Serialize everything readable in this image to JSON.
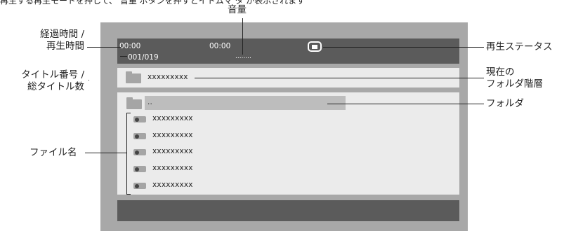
{
  "top_text": "再生する再生モードを押して、 音量 ボタンを押すとイトムマ タ  が表示されます",
  "labels": {
    "volume": "音量",
    "elapsed_total_time": "経過時間 /\n再生時間",
    "title_number": "タイトル番号 /\n総タイトル数",
    "file_name": "ファイル名",
    "play_status": "再生ステータス",
    "current_folder": "現在の\nフォルダ階層",
    "folder": "フォルダ"
  },
  "status_bar": {
    "elapsed": "00:00",
    "total": "00:00",
    "track": "001/019",
    "volume_dots": "........",
    "play_state_icon": "stop-icon"
  },
  "current_folder_name": "xxxxxxxxx",
  "folder_entry": "..",
  "files": [
    "xxxxxxxxx",
    "xxxxxxxxx",
    "xxxxxxxxx",
    "xxxxxxxxx",
    "xxxxxxxxx"
  ],
  "colors": {
    "screen_frame": "#a8a8a8",
    "dark_bar": "#5b5b5b",
    "panel": "#ebebeb",
    "highlight": "#bdbdbd",
    "icon_gray": "#a5a5a5"
  }
}
